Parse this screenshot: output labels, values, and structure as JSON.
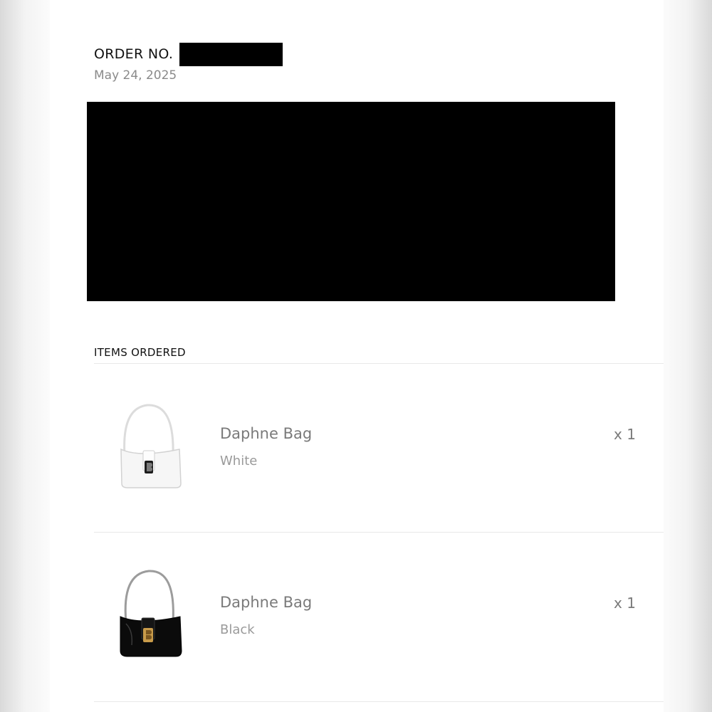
{
  "order": {
    "label": "ORDER NO.",
    "date": "May 24, 2025"
  },
  "items_section": {
    "title": "ITEMS ORDERED"
  },
  "items": [
    {
      "name": "Daphne Bag",
      "variant": "White",
      "quantity": "x 1",
      "image": "white-shoulder-bag",
      "bag_color": "#f6f6f6"
    },
    {
      "name": "Daphne Bag",
      "variant": "Black",
      "quantity": "x 1",
      "image": "black-shoulder-bag",
      "bag_color": "#0b0b0b"
    }
  ],
  "colors": {
    "redaction": "#000000",
    "muted_text": "#7a7a7a",
    "divider": "#e8e8e8"
  }
}
